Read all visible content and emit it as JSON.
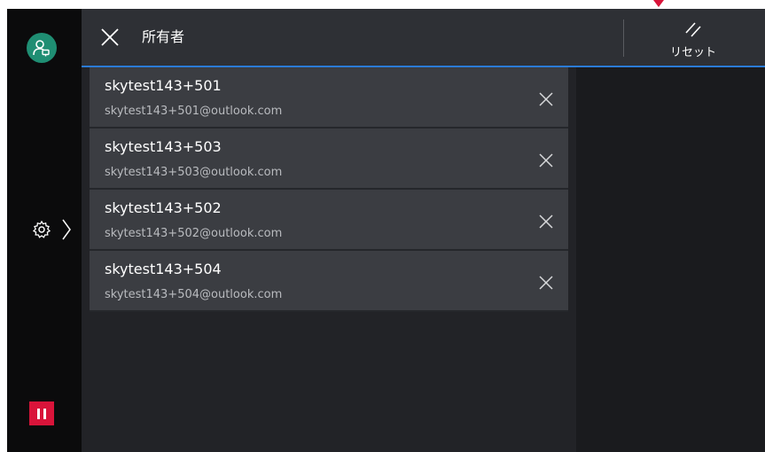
{
  "header": {
    "title": "所有者",
    "reset_label": "リセット"
  },
  "owners": [
    {
      "name": "skytest143+501",
      "email": "skytest143+501@outlook.com"
    },
    {
      "name": "skytest143+503",
      "email": "skytest143+503@outlook.com"
    },
    {
      "name": "skytest143+502",
      "email": "skytest143+502@outlook.com"
    },
    {
      "name": "skytest143+504",
      "email": "skytest143+504@outlook.com"
    }
  ],
  "colors": {
    "accent_blue": "#2b7bd6",
    "user_avatar_green": "#1f8e73",
    "pause_red": "#d9143a"
  },
  "icons": [
    "user-icon",
    "settings-gear-icon",
    "chevron-right-icon",
    "pause-icon",
    "close-icon",
    "reset-icon",
    "remove-icon"
  ]
}
